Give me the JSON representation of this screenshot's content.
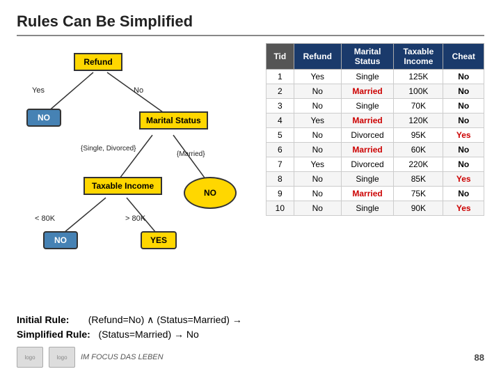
{
  "title": "Rules Can Be Simplified",
  "tree": {
    "nodes": {
      "refund": "Refund",
      "marital": "Marital Status",
      "taxable": "Taxable Income",
      "no_circle": "NO",
      "no_leaf1": "NO",
      "no_leaf2": "NO",
      "yes_leaf": "YES"
    },
    "edge_labels": {
      "yes": "Yes",
      "no": "No",
      "single_divorced": "{Single, Divorced}",
      "married": "{Married}",
      "lt80k": "< 80K",
      "gt80k": "> 80K"
    }
  },
  "table": {
    "headers": [
      "Tid",
      "Refund",
      "Marital Status",
      "Taxable Income",
      "Cheat"
    ],
    "rows": [
      {
        "tid": 1,
        "refund": "Yes",
        "marital": "Single",
        "taxable": "125K",
        "cheat": "No"
      },
      {
        "tid": 2,
        "refund": "No",
        "marital": "Married",
        "taxable": "100K",
        "cheat": "No"
      },
      {
        "tid": 3,
        "refund": "No",
        "marital": "Single",
        "taxable": "70K",
        "cheat": "No"
      },
      {
        "tid": 4,
        "refund": "Yes",
        "marital": "Married",
        "taxable": "120K",
        "cheat": "No"
      },
      {
        "tid": 5,
        "refund": "No",
        "marital": "Divorced",
        "taxable": "95K",
        "cheat": "Yes"
      },
      {
        "tid": 6,
        "refund": "No",
        "marital": "Married",
        "taxable": "60K",
        "cheat": "No"
      },
      {
        "tid": 7,
        "refund": "Yes",
        "marital": "Divorced",
        "taxable": "220K",
        "cheat": "No"
      },
      {
        "tid": 8,
        "refund": "No",
        "marital": "Single",
        "taxable": "85K",
        "cheat": "Yes"
      },
      {
        "tid": 9,
        "refund": "No",
        "marital": "Married",
        "taxable": "75K",
        "cheat": "No"
      },
      {
        "tid": 10,
        "refund": "No",
        "marital": "Single",
        "taxable": "90K",
        "cheat": "Yes"
      }
    ]
  },
  "bottom": {
    "initial_rule_label": "Initial Rule:",
    "initial_rule_text": "(Refund=No) ∧ (Status=Married) →",
    "simplified_rule_label": "Simplified Rule:",
    "simplified_rule_text": "(Status=Married) → No"
  },
  "footer": {
    "brand": "IM FOCUS DAS LEBEN",
    "page_num": "88"
  }
}
